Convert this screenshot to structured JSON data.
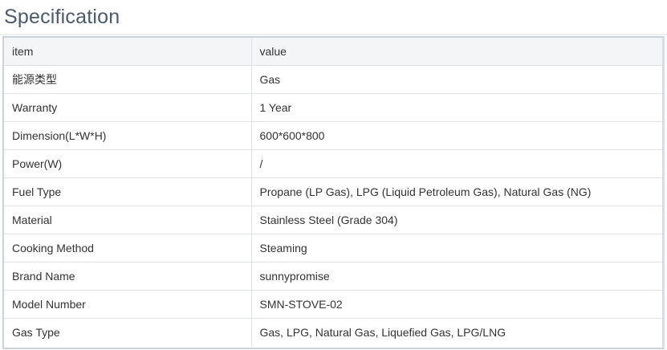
{
  "title": "Specification",
  "table": {
    "headers": {
      "item": "item",
      "value": "value"
    },
    "rows": [
      {
        "item": "能源类型",
        "value": "Gas"
      },
      {
        "item": "Warranty",
        "value": "1 Year"
      },
      {
        "item": "Dimension(L*W*H)",
        "value": "600*600*800"
      },
      {
        "item": "Power(W)",
        "value": "/"
      },
      {
        "item": "Fuel Type",
        "value": "Propane (LP Gas), LPG (Liquid Petroleum Gas), Natural Gas (NG)"
      },
      {
        "item": "Material",
        "value": "Stainless Steel (Grade 304)"
      },
      {
        "item": "Cooking Method",
        "value": "Steaming"
      },
      {
        "item": "Brand Name",
        "value": "sunnypromise"
      },
      {
        "item": "Model Number",
        "value": "SMN-STOVE-02"
      },
      {
        "item": "Gas Type",
        "value": "Gas, LPG, Natural Gas, Liquefied Gas, LPG/LNG"
      }
    ]
  }
}
